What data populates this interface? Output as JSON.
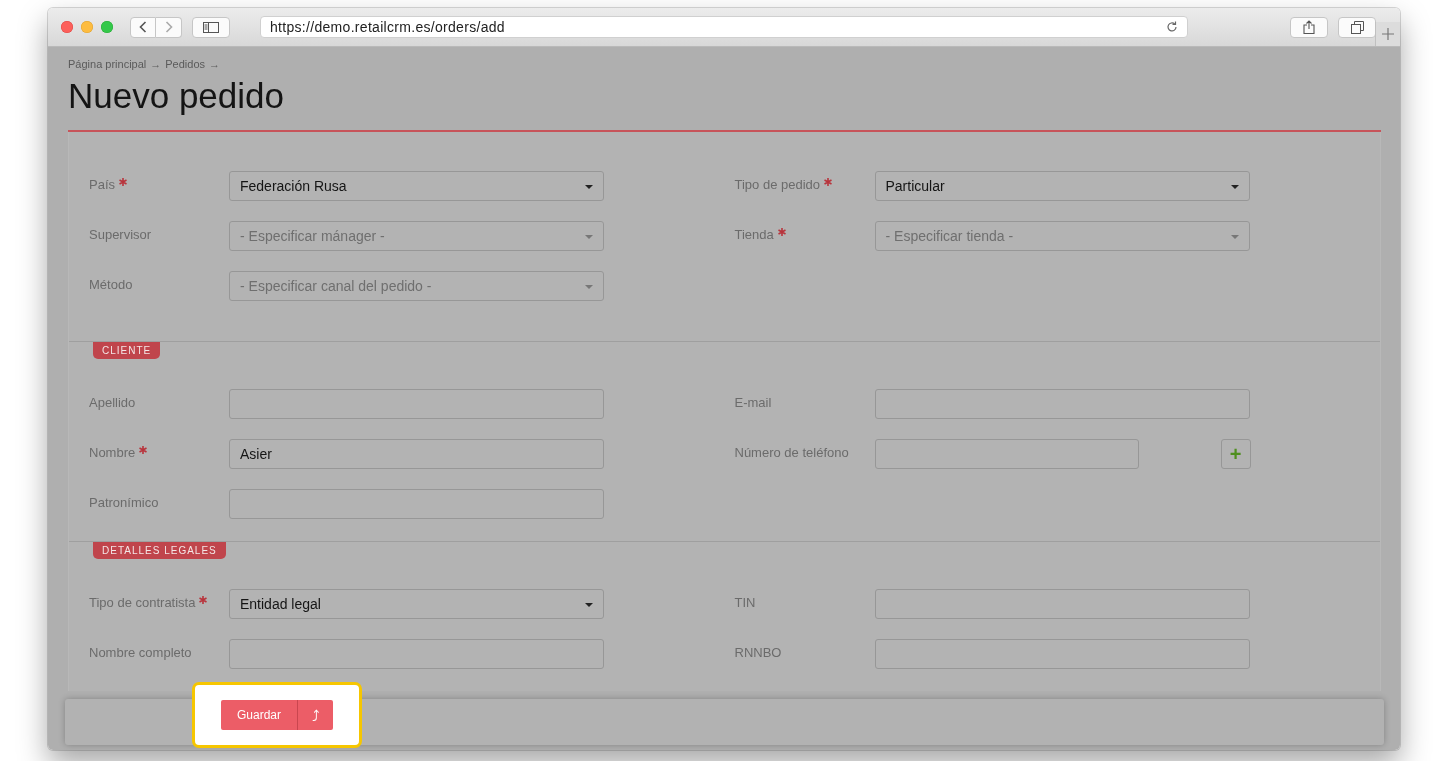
{
  "browser": {
    "url": "https://demo.retailcrm.es/orders/add"
  },
  "breadcrumb": {
    "items": [
      "Página principal",
      "Pedidos"
    ],
    "separator": "→"
  },
  "title": "Nuevo pedido",
  "sections": [
    {
      "left": [
        {
          "kind": "select",
          "label": "País",
          "required": true,
          "value": "Federación Rusa"
        },
        {
          "kind": "select",
          "label": "Supervisor",
          "required": false,
          "placeholder": "- Especificar mánager -"
        },
        {
          "kind": "select",
          "label": "Método",
          "required": false,
          "placeholder": "- Especificar canal del pedido -"
        }
      ],
      "right": [
        {
          "kind": "select",
          "label": "Tipo de pedido",
          "required": true,
          "value": "Particular"
        },
        {
          "kind": "select",
          "label": "Tienda",
          "required": true,
          "placeholder": "- Especificar tienda -"
        }
      ]
    },
    {
      "heading": "CLIENTE",
      "left": [
        {
          "kind": "text",
          "label": "Apellido",
          "required": false
        },
        {
          "kind": "text",
          "label": "Nombre",
          "required": true,
          "value": "Asier"
        },
        {
          "kind": "text",
          "label": "Patronímico",
          "required": false
        }
      ],
      "right": [
        {
          "kind": "text",
          "label": "E-mail",
          "required": false
        },
        {
          "kind": "phone",
          "label": "Número de teléfono",
          "required": false,
          "add_button": "+"
        }
      ]
    },
    {
      "heading": "DETALLES LEGALES",
      "left": [
        {
          "kind": "select",
          "label": "Tipo de contratista",
          "required": true,
          "value": "Entidad legal"
        },
        {
          "kind": "text",
          "label": "Nombre completo",
          "required": false
        }
      ],
      "right": [
        {
          "kind": "text",
          "label": "TIN",
          "required": false
        },
        {
          "kind": "text",
          "label": "RNNBO",
          "required": false
        }
      ]
    }
  ],
  "save_bar": {
    "button": "Guardar",
    "menu_button": "⤴",
    "highlighted": true
  }
}
